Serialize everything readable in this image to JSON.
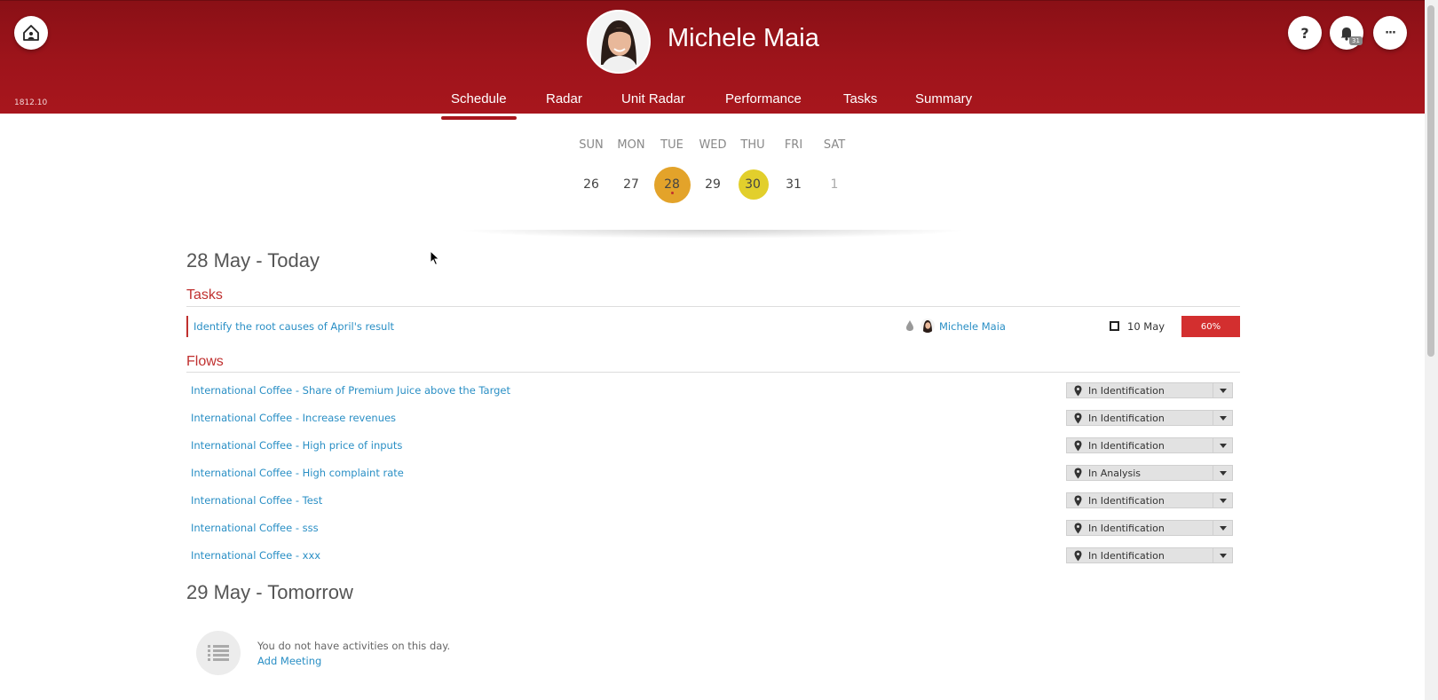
{
  "header": {
    "version": "1812.10",
    "user_name": "Michele Maia",
    "notification_count": "31",
    "help_label": "?",
    "more_label": "···",
    "accent_color": "#9e141b"
  },
  "nav": {
    "tabs": [
      {
        "label": "Schedule",
        "active": true
      },
      {
        "label": "Radar"
      },
      {
        "label": "Unit Radar"
      },
      {
        "label": "Performance"
      },
      {
        "label": "Tasks"
      },
      {
        "label": "Summary"
      }
    ]
  },
  "week": {
    "days": [
      "SUN",
      "MON",
      "TUE",
      "WED",
      "THU",
      "FRI",
      "SAT"
    ],
    "dates": [
      "26",
      "27",
      "28",
      "29",
      "30",
      "31",
      "1"
    ],
    "today_color": "#e3a32a",
    "highlight_color": "#e2cf2c"
  },
  "today": {
    "title": "28 May - Today",
    "tasks_title": "Tasks",
    "task": {
      "title": "Identify the root causes of April's result",
      "assignee": "Michele Maia",
      "date": "10 May",
      "progress": "60%"
    },
    "flows_title": "Flows",
    "flows": [
      {
        "title": "International Coffee - Share of Premium Juice above the Target",
        "status": "In Identification"
      },
      {
        "title": "International Coffee - Increase revenues",
        "status": "In Identification"
      },
      {
        "title": "International Coffee - High price of inputs",
        "status": "In Identification"
      },
      {
        "title": "International Coffee - High complaint rate",
        "status": "In Analysis"
      },
      {
        "title": "International Coffee - Test",
        "status": "In Identification"
      },
      {
        "title": "International Coffee - sss",
        "status": "In Identification"
      },
      {
        "title": "International Coffee - xxx",
        "status": "In Identification"
      }
    ]
  },
  "tomorrow": {
    "title": "29 May - Tomorrow",
    "empty_text": "You do not have activities on this day.",
    "add_meeting": "Add Meeting"
  }
}
